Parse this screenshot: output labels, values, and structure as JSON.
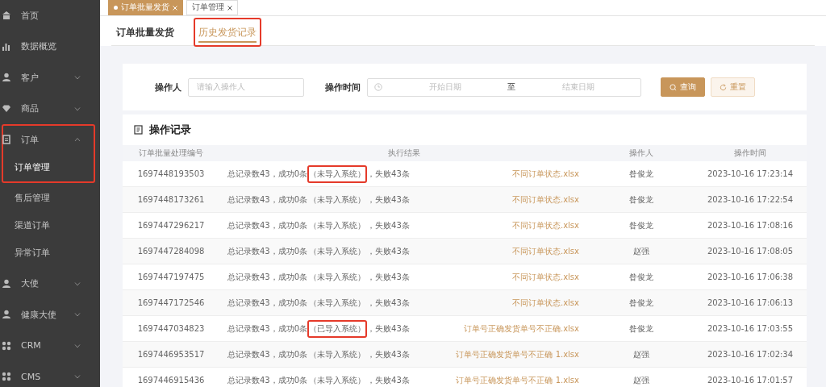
{
  "sidebar": {
    "items": [
      {
        "label": "首页",
        "kind": "home",
        "expandable": false
      },
      {
        "label": "数据概览",
        "kind": "chart",
        "expandable": false
      },
      {
        "label": "客户",
        "kind": "person",
        "expandable": true,
        "expanded": false
      },
      {
        "label": "商品",
        "kind": "diamond",
        "expandable": true,
        "expanded": false
      },
      {
        "label": "订单",
        "kind": "doc",
        "expandable": true,
        "expanded": true,
        "highlighted": true,
        "children": [
          {
            "label": "订单管理",
            "selected": true
          },
          {
            "label": "售后管理",
            "selected": false
          },
          {
            "label": "渠道订单",
            "selected": false
          },
          {
            "label": "异常订单",
            "selected": false
          }
        ]
      },
      {
        "label": "大使",
        "kind": "person",
        "expandable": true,
        "expanded": false
      },
      {
        "label": "健康大使",
        "kind": "person",
        "expandable": true,
        "expanded": false
      },
      {
        "label": "CRM",
        "kind": "grid",
        "expandable": true,
        "expanded": false
      },
      {
        "label": "CMS",
        "kind": "grid",
        "expandable": true,
        "expanded": false
      }
    ]
  },
  "open_tabs": [
    {
      "label": "订单批量发货",
      "selected": true
    },
    {
      "label": "订单管理",
      "selected": false
    }
  ],
  "page_tabs": [
    {
      "label": "订单批量发货",
      "selected": false,
      "highlighted": false
    },
    {
      "label": "历史发货记录",
      "selected": true,
      "highlighted": true
    }
  ],
  "filters": {
    "operator_label": "操作人",
    "operator_placeholder": "请输入操作人",
    "time_label": "操作时间",
    "start_placeholder": "开始日期",
    "separator": "至",
    "end_placeholder": "结束日期",
    "search_button": "查询",
    "reset_button": "重置"
  },
  "records": {
    "title": "操作记录",
    "columns": [
      "订单批量处理编号",
      "执行结果",
      "操作人",
      "操作时间"
    ],
    "rows": [
      {
        "id": "1697448193503",
        "summary": "总记录数43，成功0条",
        "status": "（未导入系统）",
        "failed": "，失败43条",
        "highlighted": true,
        "file": "不同订单状态.xlsx",
        "operator": "昝俊龙",
        "time": "2023-10-16 17:23:14"
      },
      {
        "id": "1697448173261",
        "summary": "总记录数43，成功0条",
        "status": "（未导入系统）",
        "failed": "，失败43条",
        "highlighted": false,
        "file": "不同订单状态.xlsx",
        "operator": "昝俊龙",
        "time": "2023-10-16 17:22:54"
      },
      {
        "id": "1697447296217",
        "summary": "总记录数43，成功0条",
        "status": "（未导入系统）",
        "failed": "，失败43条",
        "highlighted": false,
        "file": "不同订单状态.xlsx",
        "operator": "昝俊龙",
        "time": "2023-10-16 17:08:16"
      },
      {
        "id": "1697447284098",
        "summary": "总记录数43，成功0条",
        "status": "（未导入系统）",
        "failed": "，失败43条",
        "highlighted": false,
        "file": "不同订单状态.xlsx",
        "operator": "赵强",
        "time": "2023-10-16 17:08:05"
      },
      {
        "id": "1697447197475",
        "summary": "总记录数43，成功0条",
        "status": "（未导入系统）",
        "failed": "，失败43条",
        "highlighted": false,
        "file": "不同订单状态.xlsx",
        "operator": "昝俊龙",
        "time": "2023-10-16 17:06:38"
      },
      {
        "id": "1697447172546",
        "summary": "总记录数43，成功0条",
        "status": "（未导入系统）",
        "failed": "，失败43条",
        "highlighted": false,
        "file": "不同订单状态.xlsx",
        "operator": "昝俊龙",
        "time": "2023-10-16 17:06:13"
      },
      {
        "id": "1697447034823",
        "summary": "总记录数43，成功0条",
        "status": "（已导入系统）",
        "failed": "，失败43条",
        "highlighted": true,
        "file": "订单号正确发货单号不正确.xlsx",
        "operator": "昝俊龙",
        "time": "2023-10-16 17:03:55"
      },
      {
        "id": "1697446953517",
        "summary": "总记录数43，成功0条",
        "status": "（未导入系统）",
        "failed": "，失败43条",
        "highlighted": false,
        "file": "订单号正确发货单号不正确 1.xlsx",
        "operator": "赵强",
        "time": "2023-10-16 17:02:34"
      },
      {
        "id": "1697446915436",
        "summary": "总记录数43，成功0条",
        "status": "（未导入系统）",
        "failed": "，失败43条",
        "highlighted": false,
        "file": "订单号正确发货单号不正确 1.xlsx",
        "operator": "赵强",
        "time": "2023-10-16 17:01:57"
      }
    ]
  }
}
